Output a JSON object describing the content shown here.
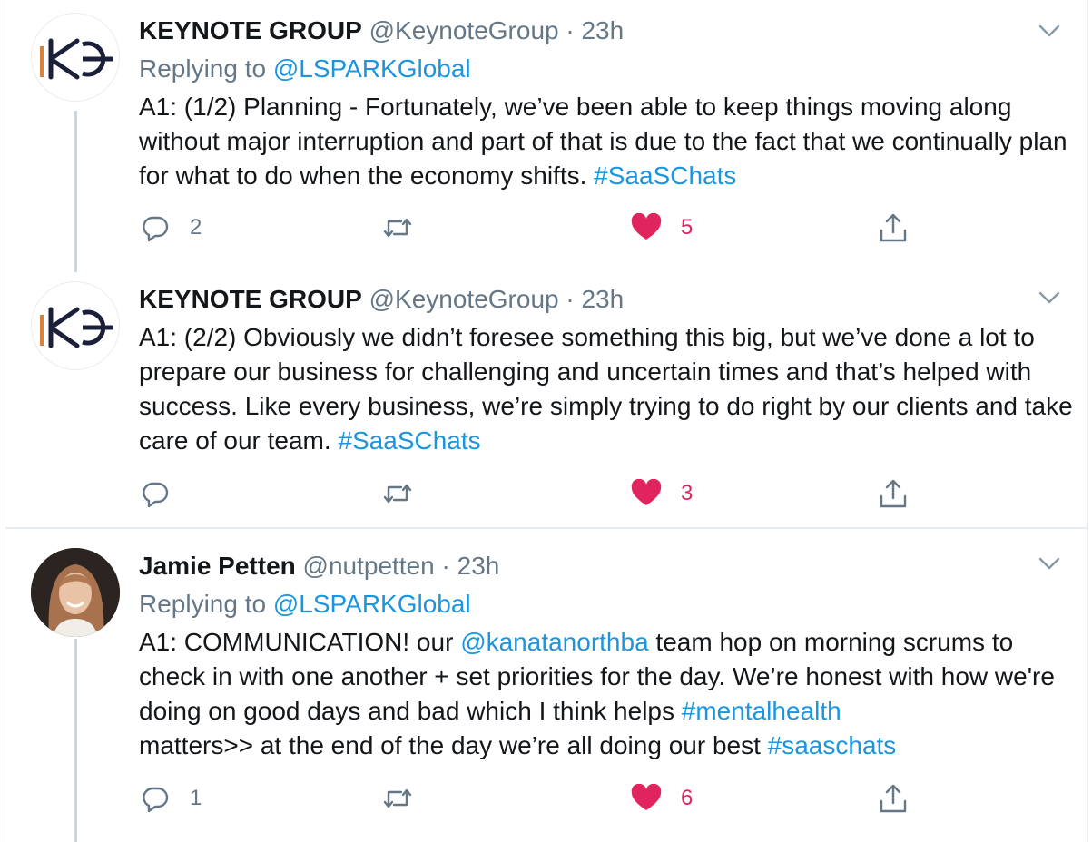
{
  "tweets": [
    {
      "name": "KEYNOTE GROUP",
      "handle": "@KeynoteGroup",
      "separator": "·",
      "time": "23h",
      "replying_prefix": "Replying to ",
      "replying_to": "@LSPARKGlobal",
      "text": "A1: (1/2) Planning - Fortunately, we’ve been able to keep things moving along without major interruption and part of that is due to the fact that we continually plan for what to do when the economy shifts. ",
      "hashtag": "#SaaSChats",
      "replies": "2",
      "likes": "5"
    },
    {
      "name": "KEYNOTE GROUP",
      "handle": "@KeynoteGroup",
      "separator": "·",
      "time": "23h",
      "text": "A1: (2/2) Obviously we didn’t foresee something this big, but we’ve done a lot to prepare our business for challenging and uncertain times and that’s helped with success. Like every business, we’re simply trying to do right by our clients and take care of our team. ",
      "hashtag": "#SaaSChats",
      "likes": "3"
    },
    {
      "name": "Jamie Petten",
      "handle": "@nutpetten",
      "separator": "·",
      "time": "23h",
      "replying_prefix": "Replying to ",
      "replying_to": "@LSPARKGlobal",
      "text_a": "A1: COMMUNICATION! our ",
      "mention": "@kanatanorthba",
      "text_b": " team hop on morning scrums to check in with one another + set priorities for the day. We’re honest with how we're doing on good days and bad which I think helps ",
      "hashtag_a": "#mentalhealth",
      "text_c": " matters>> at the end of the day we’re all doing our best ",
      "hashtag_b": "#saaschats",
      "replies": "1",
      "likes": "6"
    }
  ],
  "colors": {
    "link": "#1b95e0",
    "muted": "#657786",
    "like": "#e0245e",
    "logo_accent": "#d9823b",
    "logo_dark": "#1a1f3a"
  },
  "icons": [
    "chevron-down-icon",
    "reply-icon",
    "retweet-icon",
    "heart-icon",
    "share-icon"
  ]
}
